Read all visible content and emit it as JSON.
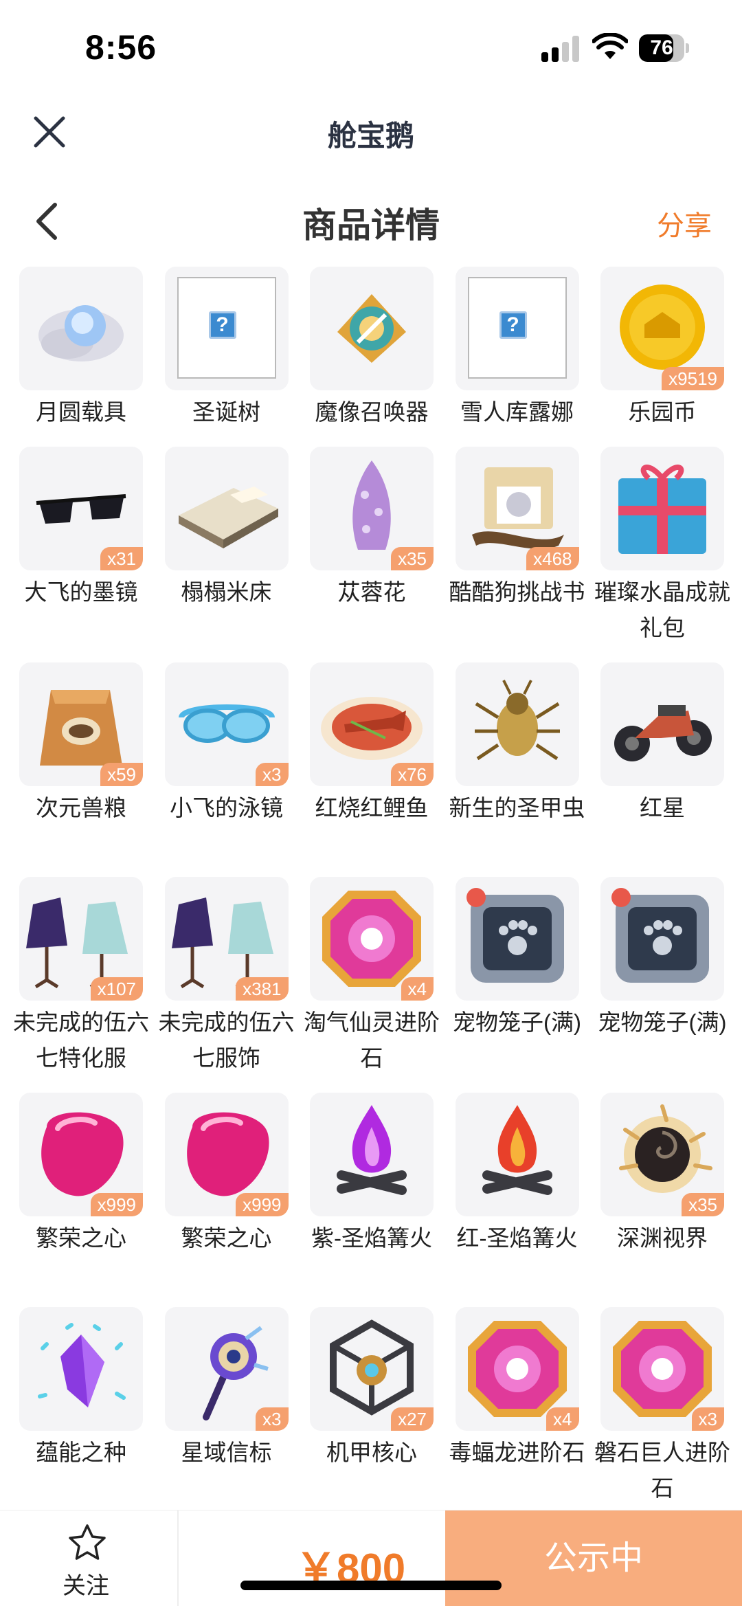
{
  "status_bar": {
    "time": "8:56",
    "battery": "76",
    "battery_level": 0.76
  },
  "mini_program": {
    "title": "舱宝鹅"
  },
  "page": {
    "title": "商品详情",
    "share": "分享"
  },
  "items": [
    {
      "name": "月圆载具",
      "qty": "",
      "icon": "moon-vehicle-icon"
    },
    {
      "name": "圣诞树",
      "qty": "",
      "icon": "image-placeholder-icon"
    },
    {
      "name": "魔像召唤器",
      "qty": "",
      "icon": "golem-summoner-icon"
    },
    {
      "name": "雪人库露娜",
      "qty": "",
      "icon": "image-placeholder-icon"
    },
    {
      "name": "乐园币",
      "qty": "x9519",
      "icon": "gold-coin-icon"
    },
    {
      "name": "大飞的墨镜",
      "qty": "x31",
      "icon": "sunglasses-icon"
    },
    {
      "name": "榻榻米床",
      "qty": "",
      "icon": "bed-icon"
    },
    {
      "name": "苁蓉花",
      "qty": "x35",
      "icon": "flower-icon"
    },
    {
      "name": "酷酷狗挑战书",
      "qty": "x468",
      "icon": "wanted-scroll-icon"
    },
    {
      "name": "璀璨水晶成就礼包",
      "qty": "",
      "icon": "gift-box-icon"
    },
    {
      "name": "次元兽粮",
      "qty": "x59",
      "icon": "food-bag-icon"
    },
    {
      "name": "小飞的泳镜",
      "qty": "x3",
      "icon": "goggles-icon"
    },
    {
      "name": "红烧红鲤鱼",
      "qty": "x76",
      "icon": "fish-dish-icon"
    },
    {
      "name": "新生的圣甲虫",
      "qty": "",
      "icon": "beetle-icon"
    },
    {
      "name": "红星",
      "qty": "",
      "icon": "motorcycle-icon"
    },
    {
      "name": "未完成的伍六七特化服",
      "qty": "x107",
      "icon": "outfit-icon"
    },
    {
      "name": "未完成的伍六七服饰",
      "qty": "x381",
      "icon": "outfit-icon"
    },
    {
      "name": "淘气仙灵进阶石",
      "qty": "x4",
      "icon": "gem-stone-icon"
    },
    {
      "name": "宠物笼子(满)",
      "qty": "",
      "icon": "pet-cage-icon"
    },
    {
      "name": "宠物笼子(满)",
      "qty": "",
      "icon": "pet-cage-icon"
    },
    {
      "name": "繁荣之心",
      "qty": "x999",
      "icon": "pink-heart-gem-icon"
    },
    {
      "name": "繁荣之心",
      "qty": "x999",
      "icon": "pink-heart-gem-icon"
    },
    {
      "name": "紫-圣焰篝火",
      "qty": "",
      "icon": "purple-bonfire-icon"
    },
    {
      "name": "红-圣焰篝火",
      "qty": "",
      "icon": "red-bonfire-icon"
    },
    {
      "name": "深渊视界",
      "qty": "x35",
      "icon": "abyss-vortex-icon"
    },
    {
      "name": "蕴能之种",
      "qty": "",
      "icon": "crystal-seed-icon"
    },
    {
      "name": "星域信标",
      "qty": "x3",
      "icon": "star-beacon-icon"
    },
    {
      "name": "机甲核心",
      "qty": "x27",
      "icon": "mech-core-icon"
    },
    {
      "name": "毒蝠龙进阶石",
      "qty": "x4",
      "icon": "gem-stone-icon"
    },
    {
      "name": "磐石巨人进阶石",
      "qty": "x3",
      "icon": "gem-stone-icon"
    }
  ],
  "bottom_bar": {
    "follow": "关注",
    "price": "￥800",
    "status": "公示中"
  },
  "colors": {
    "accent": "#f07b2a",
    "status_button": "#f8ad7e",
    "qty_badge": "#f5a06e"
  }
}
